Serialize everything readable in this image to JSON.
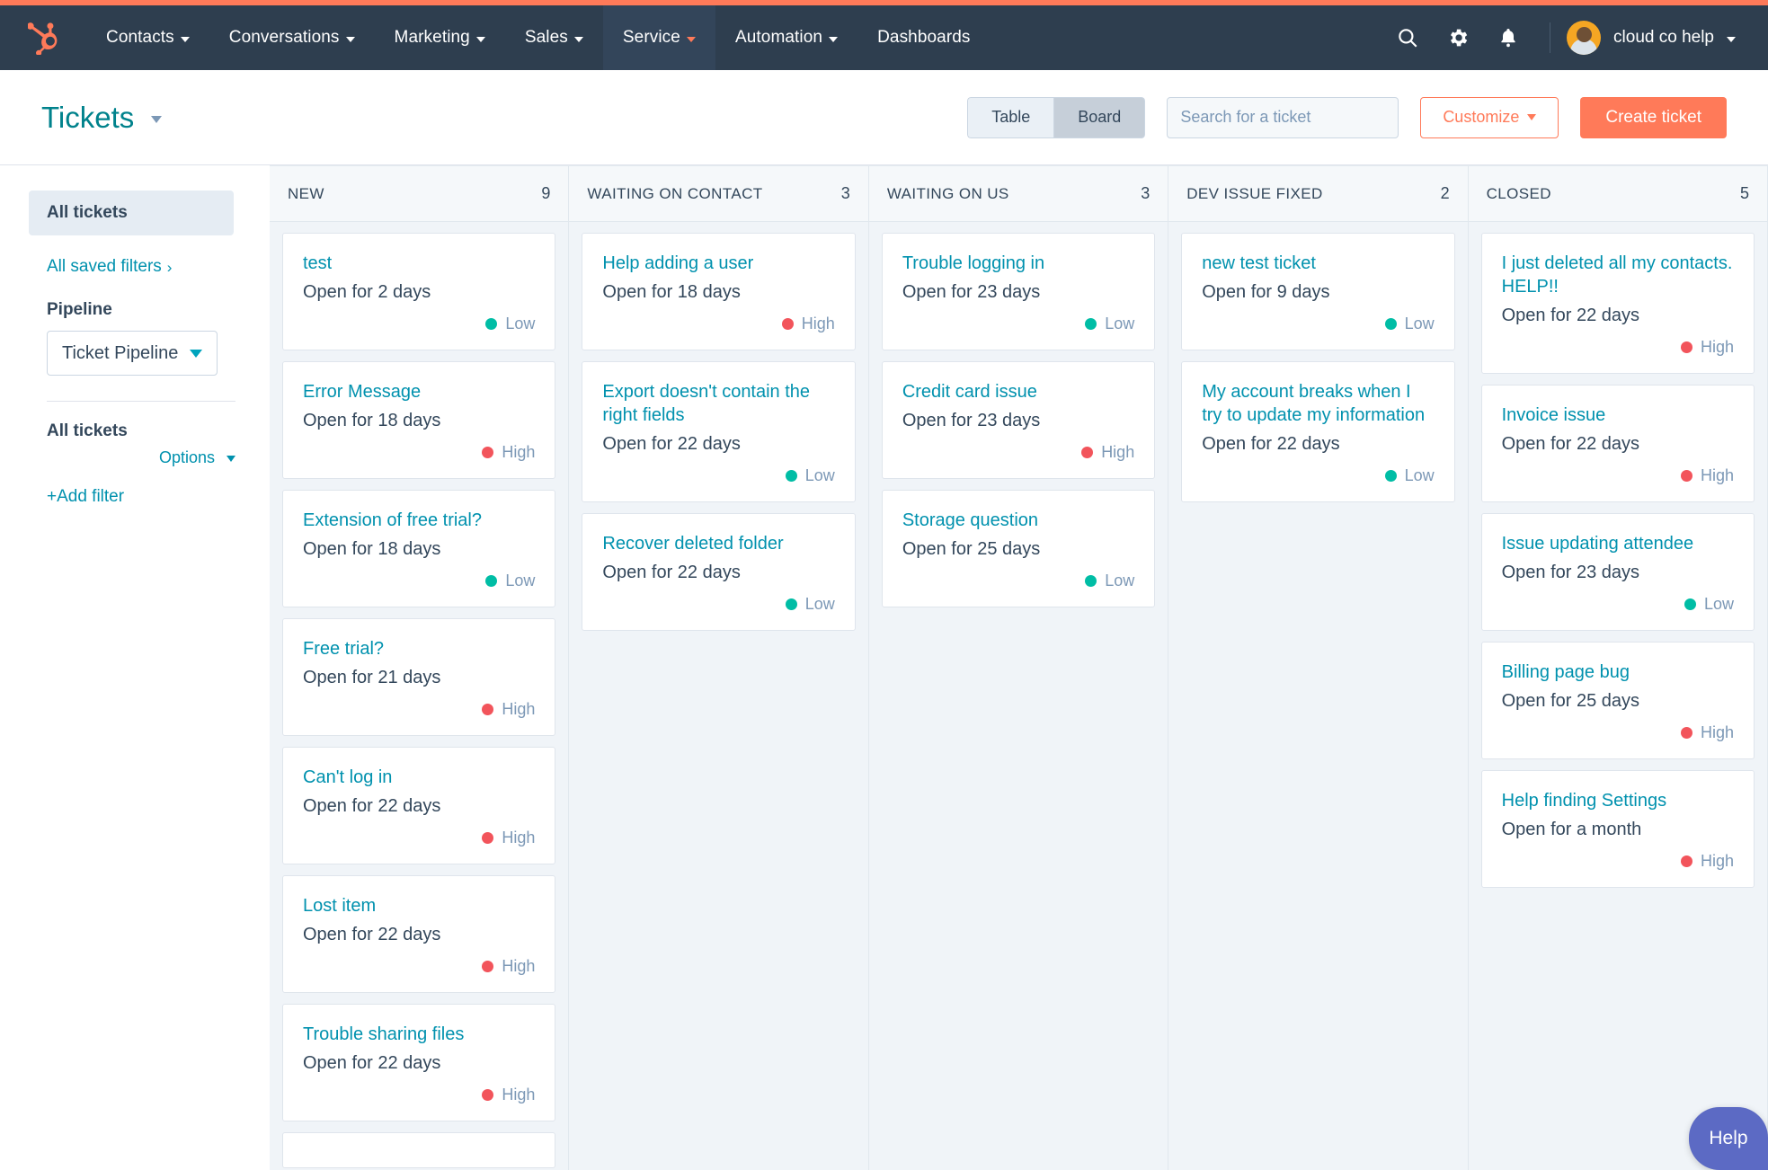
{
  "colors": {
    "brand_orange": "#ff7a59",
    "navbar_bg": "#2e3e4f",
    "link_teal": "#0091ae",
    "title_teal": "#00828c",
    "priority_low": "#00bda5",
    "priority_high": "#f2545b",
    "board_bg": "#f0f4f8",
    "help_purple": "#5c6ac4"
  },
  "navbar": {
    "logo_icon": "hubspot-sprocket-icon",
    "items": [
      {
        "label": "Contacts",
        "has_caret": true,
        "active": false
      },
      {
        "label": "Conversations",
        "has_caret": true,
        "active": false
      },
      {
        "label": "Marketing",
        "has_caret": true,
        "active": false
      },
      {
        "label": "Sales",
        "has_caret": true,
        "active": false
      },
      {
        "label": "Service",
        "has_caret": true,
        "active": true
      },
      {
        "label": "Automation",
        "has_caret": true,
        "active": false
      },
      {
        "label": "Dashboards",
        "has_caret": false,
        "active": false
      }
    ],
    "icons": [
      "search-icon",
      "gear-icon",
      "bell-icon"
    ],
    "user_name": "cloud co help"
  },
  "header": {
    "title": "Tickets",
    "view_toggle": {
      "options": [
        "Table",
        "Board"
      ],
      "selected": "Board"
    },
    "search": {
      "placeholder": "Search for a ticket",
      "value": ""
    },
    "customize_label": "Customize",
    "create_label": "Create ticket"
  },
  "sidebar": {
    "all_tickets_label": "All tickets",
    "saved_filters_label": "All saved filters",
    "pipeline_label": "Pipeline",
    "pipeline_value": "Ticket Pipeline",
    "filter_group_label": "All tickets",
    "options_label": "Options",
    "add_filter_label": "+Add filter"
  },
  "board": {
    "columns": [
      {
        "name": "NEW",
        "count": "9",
        "cards": [
          {
            "title": "test",
            "age": "Open for 2 days",
            "priority": "Low",
            "priority_level": "low"
          },
          {
            "title": "Error Message",
            "age": "Open for 18 days",
            "priority": "High",
            "priority_level": "high"
          },
          {
            "title": "Extension of free trial?",
            "age": "Open for 18 days",
            "priority": "Low",
            "priority_level": "low"
          },
          {
            "title": "Free trial?",
            "age": "Open for 21 days",
            "priority": "High",
            "priority_level": "high"
          },
          {
            "title": "Can't log in",
            "age": "Open for 22 days",
            "priority": "High",
            "priority_level": "high"
          },
          {
            "title": "Lost item",
            "age": "Open for 22 days",
            "priority": "High",
            "priority_level": "high"
          },
          {
            "title": "Trouble sharing files",
            "age": "Open for 22 days",
            "priority": "High",
            "priority_level": "high"
          }
        ]
      },
      {
        "name": "WAITING ON CONTACT",
        "count": "3",
        "cards": [
          {
            "title": "Help adding a user",
            "age": "Open for 18 days",
            "priority": "High",
            "priority_level": "high"
          },
          {
            "title": "Export doesn't contain the right fields",
            "age": "Open for 22 days",
            "priority": "Low",
            "priority_level": "low"
          },
          {
            "title": "Recover deleted folder",
            "age": "Open for 22 days",
            "priority": "Low",
            "priority_level": "low"
          }
        ]
      },
      {
        "name": "WAITING ON US",
        "count": "3",
        "cards": [
          {
            "title": "Trouble logging in",
            "age": "Open for 23 days",
            "priority": "Low",
            "priority_level": "low"
          },
          {
            "title": "Credit card issue",
            "age": "Open for 23 days",
            "priority": "High",
            "priority_level": "high"
          },
          {
            "title": "Storage question",
            "age": "Open for 25 days",
            "priority": "Low",
            "priority_level": "low"
          }
        ]
      },
      {
        "name": "DEV ISSUE FIXED",
        "count": "2",
        "cards": [
          {
            "title": "new test ticket",
            "age": "Open for 9 days",
            "priority": "Low",
            "priority_level": "low"
          },
          {
            "title": "My account breaks when I try to update my information",
            "age": "Open for 22 days",
            "priority": "Low",
            "priority_level": "low"
          }
        ]
      },
      {
        "name": "CLOSED",
        "count": "5",
        "cards": [
          {
            "title": "I just deleted all my contacts. HELP!!",
            "age": "Open for 22 days",
            "priority": "High",
            "priority_level": "high"
          },
          {
            "title": "Invoice issue",
            "age": "Open for 22 days",
            "priority": "High",
            "priority_level": "high"
          },
          {
            "title": "Issue updating attendee",
            "age": "Open for 23 days",
            "priority": "Low",
            "priority_level": "low"
          },
          {
            "title": "Billing page bug",
            "age": "Open for 25 days",
            "priority": "High",
            "priority_level": "high"
          },
          {
            "title": "Help finding Settings",
            "age": "Open for a month",
            "priority": "High",
            "priority_level": "high"
          }
        ]
      }
    ]
  },
  "help_widget": {
    "label": "Help"
  }
}
